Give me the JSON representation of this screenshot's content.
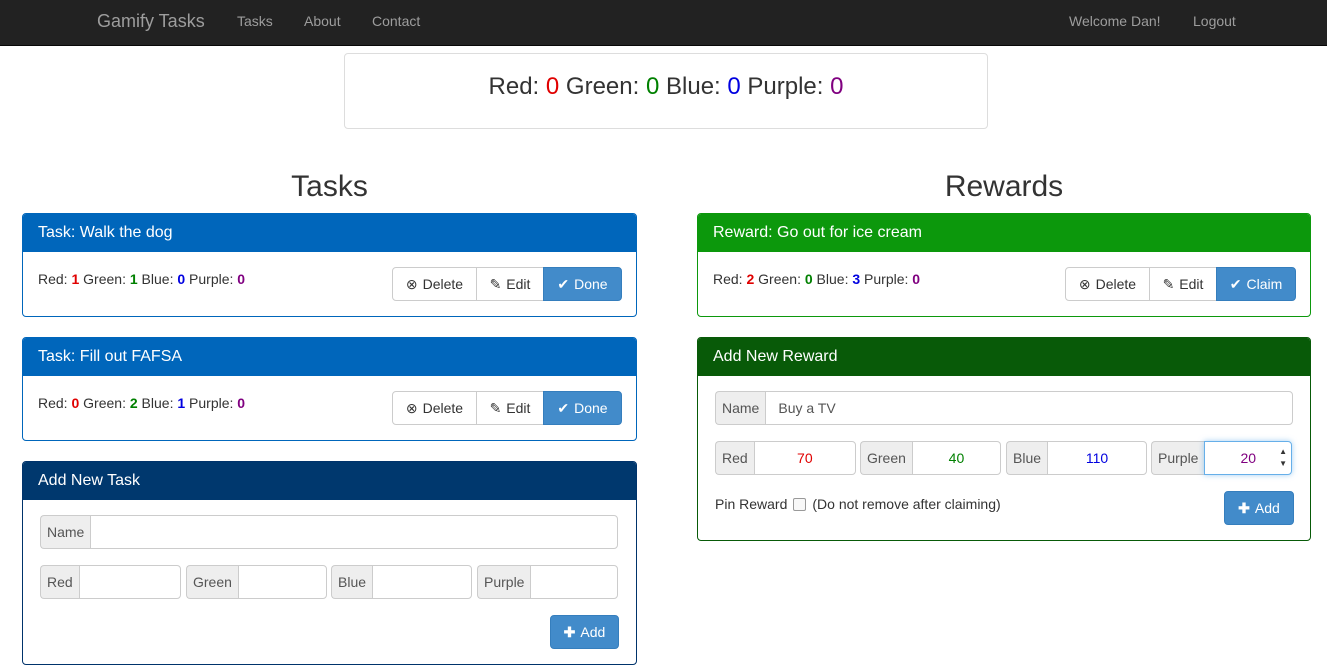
{
  "nav": {
    "brand": "Gamify Tasks",
    "links": [
      "Tasks",
      "About",
      "Contact"
    ],
    "welcome": "Welcome Dan!",
    "logout": "Logout"
  },
  "points": {
    "red_label": "Red:",
    "red": "0",
    "green_label": "Green:",
    "green": "0",
    "blue_label": "Blue:",
    "blue": "0",
    "purple_label": "Purple:",
    "purple": "0"
  },
  "colors": {
    "red": "#e00000",
    "green": "#008000",
    "blue": "#0000e0",
    "purple": "#800080",
    "task_header": "#0066bb",
    "reward_header": "#0c980c",
    "primary": "#428bca"
  },
  "tasks_title": "Tasks",
  "rewards_title": "Rewards",
  "labels": {
    "red": "Red:",
    "green": "Green:",
    "blue": "Blue:",
    "purple": "Purple:",
    "delete": "Delete",
    "edit": "Edit",
    "done": "Done",
    "claim": "Claim",
    "add": "Add"
  },
  "tasks": [
    {
      "title": "Task: Walk the dog",
      "red": "1",
      "green": "1",
      "blue": "0",
      "purple": "0"
    },
    {
      "title": "Task: Fill out FAFSA",
      "red": "0",
      "green": "2",
      "blue": "1",
      "purple": "0"
    }
  ],
  "rewards": [
    {
      "title": "Reward: Go out for ice cream",
      "red": "2",
      "green": "0",
      "blue": "3",
      "purple": "0"
    }
  ],
  "new_task": {
    "title": "Add New Task",
    "name_label": "Name",
    "name": "",
    "red_label": "Red",
    "red": "",
    "green_label": "Green",
    "green": "",
    "blue_label": "Blue",
    "blue": "",
    "purple_label": "Purple",
    "purple": ""
  },
  "new_reward": {
    "title": "Add New Reward",
    "name_label": "Name",
    "name": "Buy a TV",
    "red_label": "Red",
    "red": "70",
    "green_label": "Green",
    "green": "40",
    "blue_label": "Blue",
    "blue": "110",
    "purple_label": "Purple",
    "purple": "20",
    "pin_label": "Pin Reward",
    "pin_note": "(Do not remove after claiming)"
  },
  "icons": {
    "delete": "times-circle-icon",
    "edit": "pencil-icon",
    "done": "check-icon",
    "add": "plus-icon"
  }
}
